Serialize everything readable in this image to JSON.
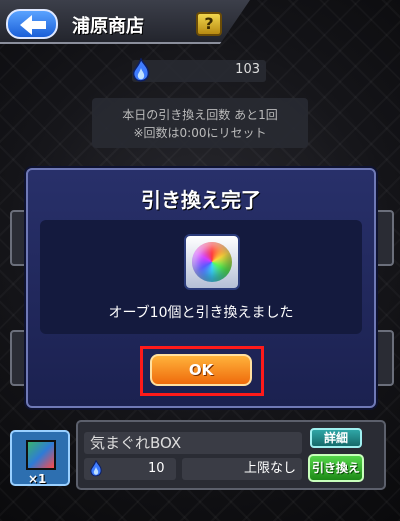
{
  "header": {
    "back_icon": "back-arrow-icon",
    "title": "浦原商店",
    "help_label": "?"
  },
  "orb_counter": {
    "icon": "blue-flame-icon",
    "value": "103"
  },
  "notice": {
    "line1": "本日の引き換え回数 あと1回",
    "line2": "※回数は0:00にリセット"
  },
  "dialog": {
    "title": "引き換え完了",
    "item_icon": "rainbow-orb-icon",
    "message": "オーブ10個と引き換えました",
    "ok_label": "OK"
  },
  "shop_item": {
    "icon": "mystery-box-icon",
    "quantity": "×1",
    "name": "気まぐれBOX",
    "detail_label": "詳細",
    "cost_icon": "blue-flame-icon",
    "cost": "10",
    "limit": "上限なし",
    "exchange_label": "引き換え"
  },
  "colors": {
    "dialog_bg": "#1b2150",
    "ok_button": "#ef6b0c",
    "highlight": "#ff1a1a",
    "exchange_button": "#1d8a17"
  }
}
